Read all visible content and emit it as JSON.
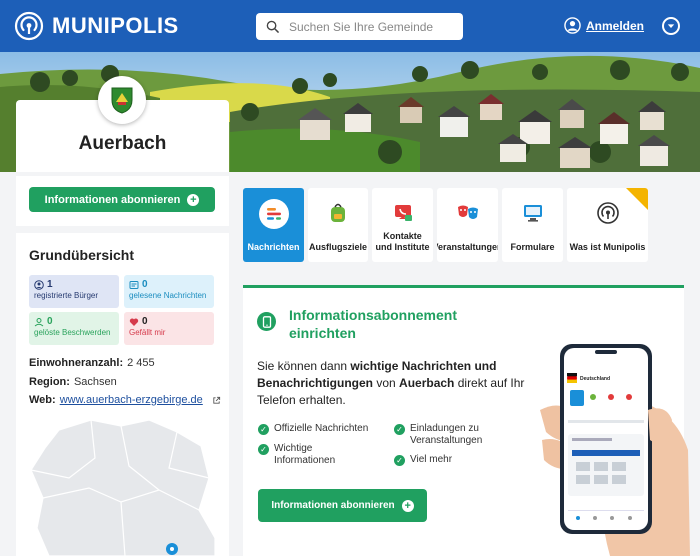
{
  "header": {
    "brand": "MUNIPOLIS",
    "search_placeholder": "Suchen Sie Ihre Gemeinde",
    "login_label": "Anmelden"
  },
  "municipality": {
    "name": "Auerbach",
    "subscribe_label": "Informationen abonnieren"
  },
  "overview": {
    "title": "Grundübersicht",
    "stats": [
      {
        "value": "1",
        "label": "registrierte Bürger"
      },
      {
        "value": "0",
        "label": "gelesene Nachrichten"
      },
      {
        "value": "0",
        "label": "gelöste Beschwerden"
      },
      {
        "value": "0",
        "label": "Gefällt mir"
      }
    ],
    "population_label": "Einwohneranzahl:",
    "population_value": "2 455",
    "region_label": "Region:",
    "region_value": "Sachsen",
    "web_label": "Web:",
    "web_value": "www.auerbach-erzgebirge.de"
  },
  "tiles": [
    {
      "label": "Nachrichten",
      "icon": "news-icon"
    },
    {
      "label": "Ausflugsziele",
      "icon": "backpack-icon"
    },
    {
      "label": "Kontakte\nund Institute",
      "icon": "phone-contact-icon"
    },
    {
      "label": "Veranstaltungen",
      "icon": "theater-masks-icon"
    },
    {
      "label": "Formulare",
      "icon": "monitor-icon"
    },
    {
      "label": "Was ist Munipolis",
      "icon": "broadcast-icon"
    }
  ],
  "subscription": {
    "title": "Informationsabonnement einrichten",
    "desc_1": "Sie können dann ",
    "desc_bold_1": "wichtige Nachrichten und Benachrichtigungen",
    "desc_2": " von ",
    "desc_bold_2": "Auerbach",
    "desc_3": " direkt auf Ihr Telefon erhalten.",
    "features": [
      "Offizielle Nachrichten",
      "Einladungen zu Veranstaltungen",
      "Wichtige Informationen",
      "Viel mehr"
    ],
    "button_label": "Informationen abonnieren"
  },
  "phone_mockup": {
    "country": "Deutschland"
  },
  "colors": {
    "brand_blue": "#1d5fb8",
    "accent_green": "#20a060",
    "active_tile": "#1a8fd8"
  }
}
